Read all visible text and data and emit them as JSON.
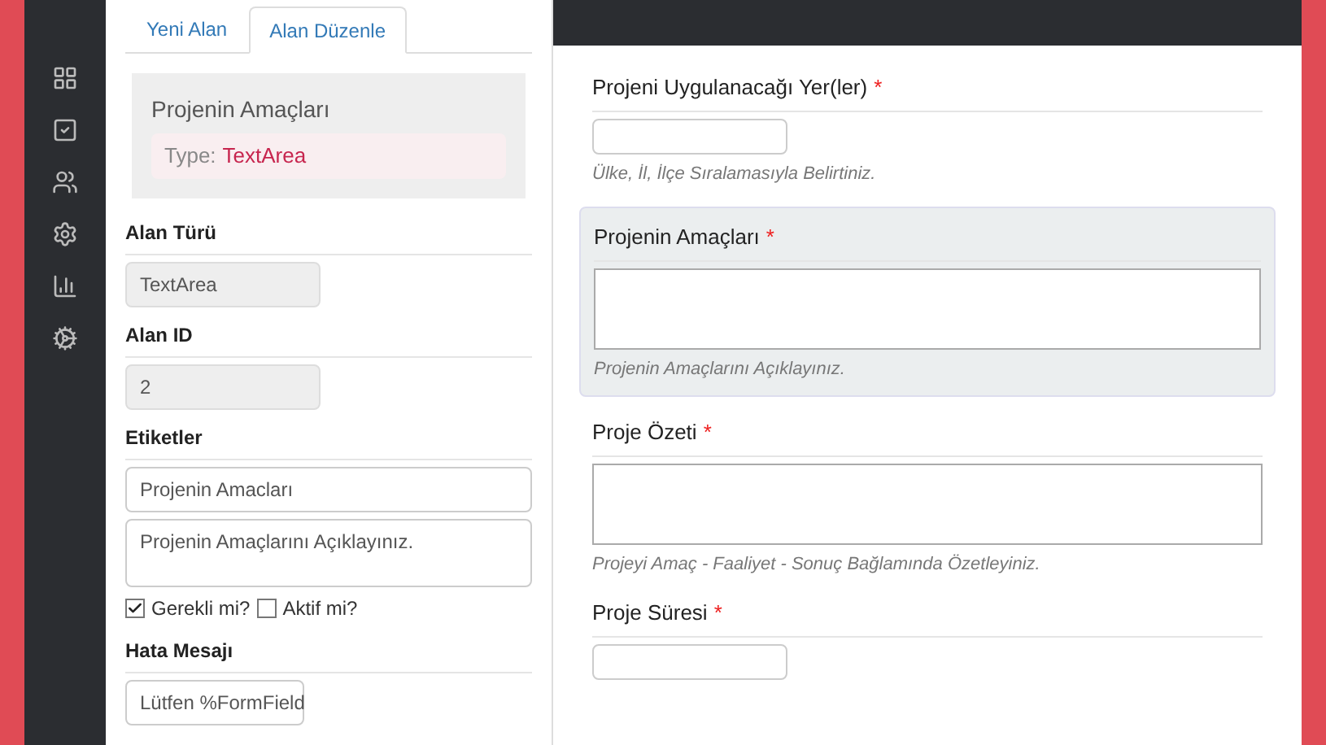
{
  "editor": {
    "tabs": [
      {
        "label": "Yeni Alan",
        "selected": false
      },
      {
        "label": "Alan Düzenle",
        "selected": true
      }
    ],
    "summary": {
      "title": "Projenin Amaçları",
      "type_label": "Type:",
      "type_value": "TextArea"
    },
    "alan_turu": {
      "label": "Alan Türü",
      "value": "TextArea"
    },
    "alan_id": {
      "label": "Alan ID",
      "value": "2"
    },
    "etiketler": {
      "label": "Etiketler",
      "title_value": "Projenin Amacları",
      "description_value": "Projenin Amaçlarını Açıklayınız."
    },
    "checks": [
      {
        "label": "Gerekli mi?",
        "checked": true
      },
      {
        "label": "Aktif mi?",
        "checked": false
      }
    ],
    "hata_mesaji": {
      "label": "Hata Mesajı",
      "value": "Lütfen %FormField"
    }
  },
  "preview": {
    "fields": [
      {
        "label": "Projeni Uygulanacağı Yer(ler)",
        "required_mark": "*",
        "kind": "input",
        "help": "Ülke, İl, İlçe Sıralamasıyla Belirtiniz.",
        "highlighted": false
      },
      {
        "label": "Projenin Amaçları",
        "required_mark": "*",
        "kind": "textarea",
        "help": "Projenin Amaçlarını Açıklayınız.",
        "highlighted": true
      },
      {
        "label": "Proje Özeti",
        "required_mark": "*",
        "kind": "textarea",
        "help": "Projeyi Amaç - Faaliyet - Sonuç Bağlamında Özetleyiniz.",
        "highlighted": false
      },
      {
        "label": "Proje Süresi",
        "required_mark": "*",
        "kind": "input",
        "highlighted": false
      }
    ]
  }
}
